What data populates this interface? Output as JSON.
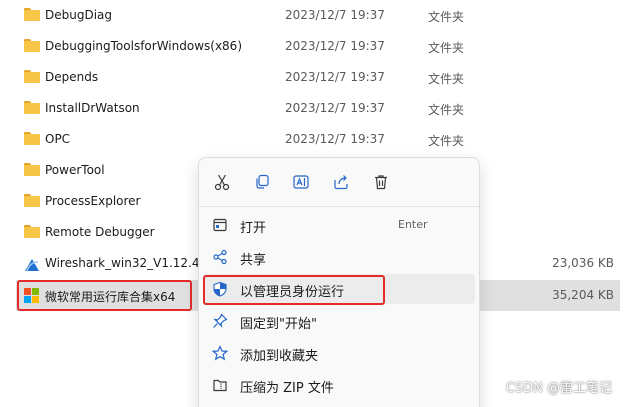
{
  "files": [
    {
      "name": "DebugDiag",
      "date": "2023/12/7 19:37",
      "type": "文件夹",
      "size": ""
    },
    {
      "name": "DebuggingToolsforWindows(x86)",
      "date": "2023/12/7 19:37",
      "type": "文件夹",
      "size": ""
    },
    {
      "name": "Depends",
      "date": "2023/12/7 19:37",
      "type": "文件夹",
      "size": ""
    },
    {
      "name": "InstallDrWatson",
      "date": "2023/12/7 19:37",
      "type": "文件夹",
      "size": ""
    },
    {
      "name": "OPC",
      "date": "2023/12/7 19:37",
      "type": "文件夹",
      "size": ""
    },
    {
      "name": "PowerTool",
      "date": "",
      "type": "",
      "size": ""
    },
    {
      "name": "ProcessExplorer",
      "date": "",
      "type": "",
      "size": ""
    },
    {
      "name": "Remote Debugger",
      "date": "",
      "type": "",
      "size": ""
    },
    {
      "name": "Wireshark_win32_V1.12.4",
      "date": "",
      "type": "",
      "size": "23,036 KB"
    },
    {
      "name": "微软常用运行库合集x64",
      "date": "",
      "type": "",
      "size": "35,204 KB"
    }
  ],
  "context_menu": {
    "toolbar": [
      "cut-icon",
      "copy-icon",
      "rename-icon",
      "share-icon",
      "delete-icon"
    ],
    "items": [
      {
        "label": "打开",
        "shortcut": "Enter",
        "icon": "open-icon"
      },
      {
        "label": "共享",
        "shortcut": "",
        "icon": "share-icon"
      },
      {
        "label": "以管理员身份运行",
        "shortcut": "",
        "icon": "shield-icon"
      },
      {
        "label": "固定到\"开始\"",
        "shortcut": "",
        "icon": "pin-icon"
      },
      {
        "label": "添加到收藏夹",
        "shortcut": "",
        "icon": "star-icon"
      },
      {
        "label": "压缩为 ZIP 文件",
        "shortcut": "",
        "icon": "zip-icon"
      }
    ]
  },
  "watermark": "CSDN @雷工笔记",
  "colors": {
    "highlight_box": "#e32b2b",
    "folder": "#f8c646",
    "selected_row": "#e0e0e0"
  }
}
